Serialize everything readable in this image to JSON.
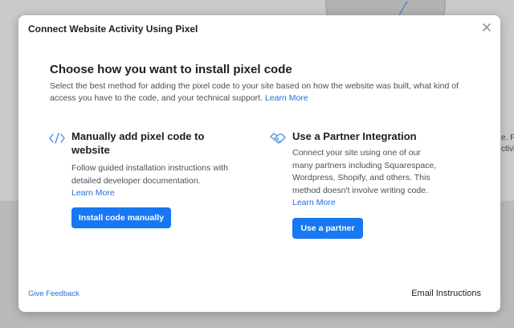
{
  "backdrop": {
    "fragment_1": "e. Fi",
    "fragment_2": "ctivi"
  },
  "modal": {
    "title": "Connect Website Activity Using Pixel",
    "close_icon": "close-icon"
  },
  "content": {
    "heading": "Choose how you want to install pixel code",
    "description": "Select the best method for adding the pixel code to your site based on how the website was built, what kind of access you have to the code, and your technical support.",
    "learn_more": "Learn More"
  },
  "options": {
    "manual": {
      "icon": "code-icon",
      "title": "Manually add pixel code to website",
      "description": "Follow guided installation instructions with detailed developer documentation.",
      "learn_more": "Learn More",
      "button": "Install code manually"
    },
    "partner": {
      "icon": "handshake-icon",
      "title": "Use a Partner Integration",
      "description": "Connect your site using one of our many partners including Squarespace, Wordpress, Shopify, and others. This method doesn't involve writing code.",
      "learn_more": "Learn More",
      "button": "Use a partner"
    }
  },
  "footer": {
    "feedback": "Give Feedback",
    "email": "Email Instructions"
  },
  "colors": {
    "accent": "#1877f2",
    "link": "#216fdb",
    "icon": "#4a90d9"
  }
}
